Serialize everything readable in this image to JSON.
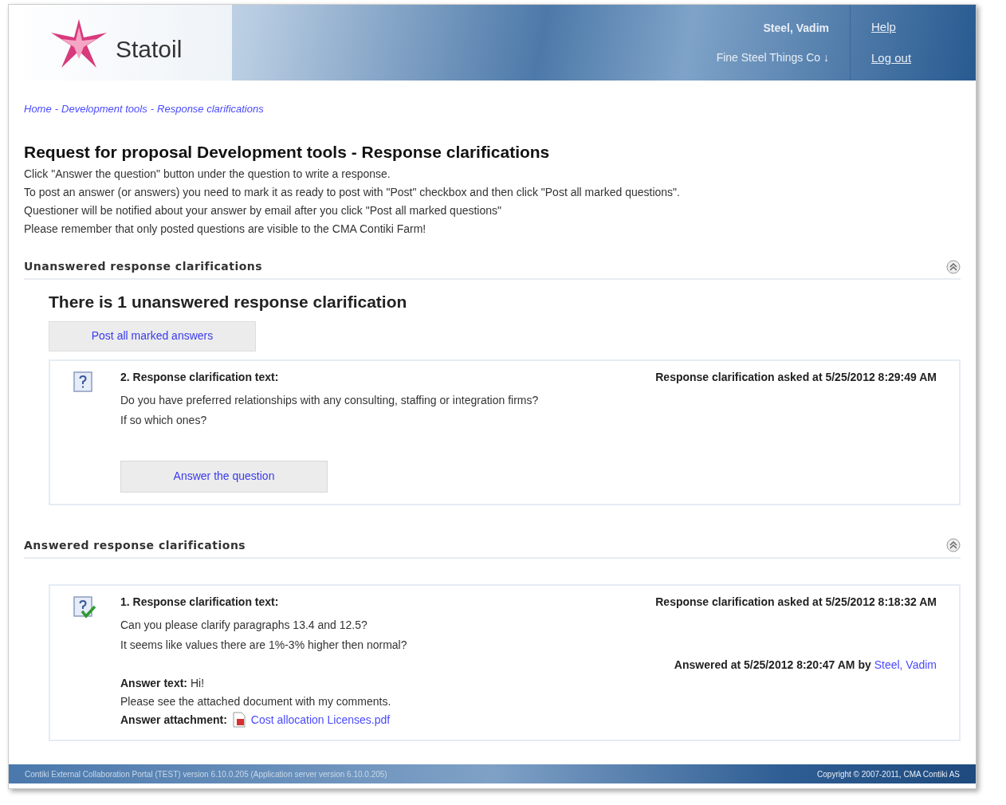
{
  "header": {
    "logo": "Statoil",
    "user": "Steel, Vadim",
    "company": "Fine Steel Things Co ↓",
    "links": [
      "Help",
      "Log out"
    ]
  },
  "breadcrumb": {
    "items": [
      "Home",
      "Development tools",
      "Response clarifications"
    ],
    "separator": "-"
  },
  "title": "Request for proposal Development tools - Response clarifications",
  "instructions": [
    "Click \"Answer the question\" button under the question to write a response.",
    "To post an answer (or answers) you need to mark it as ready to post with \"Post\" checkbox and then click \"Post all marked questions\".",
    "Questioner will be notified about your answer by email after you click \"Post all marked questions\"",
    "Please remember that only posted questions are visible to the CMA Contiki Farm!"
  ],
  "sections": [
    {
      "title": "Unanswered response clarifications",
      "summary": "There is 1 unanswered response clarification",
      "post_button": "Post all marked answers",
      "questions": [
        {
          "answered": false,
          "heading": "2. Response clarification text:",
          "asked": "Response clarification asked at 5/25/2012 8:29:49 AM",
          "lines": [
            "Do you have preferred relationships with any consulting, staffing or integration firms?",
            "If so which ones?"
          ],
          "action": "Answer the question"
        }
      ]
    },
    {
      "title": "Answered response clarifications",
      "questions": [
        {
          "answered": true,
          "heading": "1. Response clarification text:",
          "asked": "Response clarification asked at 5/25/2012 8:18:32 AM",
          "lines": [
            "Can you please clarify paragraphs 13.4 and 12.5?",
            "It seems like values there are 1%-3% higher then normal?"
          ],
          "answered_line": "Answered at 5/25/2012 8:20:47 AM by",
          "answered_by": "Steel, Vadim",
          "answer_label": "Answer text:",
          "answer_first": "Hi!",
          "answer_lines": [
            "Please see the attached document with my comments."
          ],
          "attachment_label": "Answer attachment:",
          "attachment": "Cost allocation Licenses.pdf"
        }
      ]
    }
  ],
  "footer": {
    "left": "Contiki External Collaboration Portal (TEST) version 6.10.0.205 (Application server version 6.10.0.205)",
    "right": "Copyright © 2007-2011, CMA Contiki AS"
  }
}
